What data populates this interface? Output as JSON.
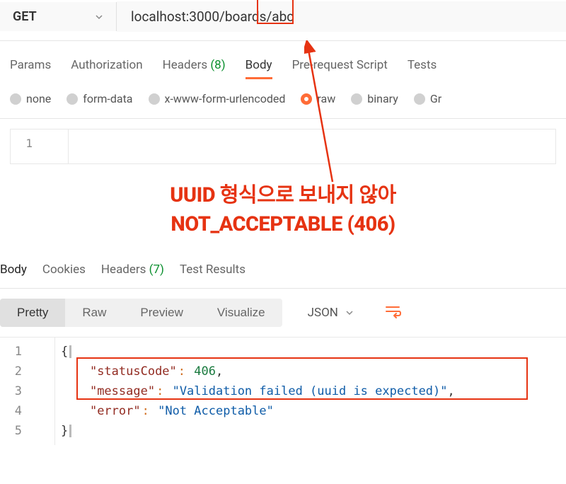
{
  "method": "GET",
  "url": "localhost:3000/boards/abc",
  "url_highlight_segment": "/abc",
  "request_tabs": [
    {
      "label": "Params"
    },
    {
      "label": "Authorization"
    },
    {
      "label": "Headers",
      "count": "(8)"
    },
    {
      "label": "Body",
      "active": true
    },
    {
      "label": "Pre-request Script"
    },
    {
      "label": "Tests"
    }
  ],
  "body_types": [
    {
      "label": "none"
    },
    {
      "label": "form-data"
    },
    {
      "label": "x-www-form-urlencoded"
    },
    {
      "label": "raw",
      "checked": true
    },
    {
      "label": "binary"
    },
    {
      "label": "Gr"
    }
  ],
  "request_editor": {
    "line_numbers": [
      "1"
    ]
  },
  "annotation": {
    "line1": "UUID 형식으로 보내지 않아",
    "line2": "NOT_ACCEPTABLE (406)"
  },
  "response_tabs": [
    {
      "label": "Body",
      "active": true
    },
    {
      "label": "Cookies"
    },
    {
      "label": "Headers",
      "count": "(7)"
    },
    {
      "label": "Test Results"
    }
  ],
  "view_modes": [
    {
      "label": "Pretty",
      "active": true
    },
    {
      "label": "Raw"
    },
    {
      "label": "Preview"
    },
    {
      "label": "Visualize"
    }
  ],
  "response_format": "JSON",
  "response_body": {
    "line_numbers": [
      "1",
      "2",
      "3",
      "4",
      "5"
    ],
    "json": {
      "statusCode": 406,
      "message": "Validation failed (uuid is expected)",
      "error": "Not Acceptable"
    },
    "tokens": [
      {
        "indent": "",
        "type": "brace",
        "text": "{"
      },
      {
        "indent": "    ",
        "key": "statusCode",
        "valType": "num",
        "val": "406",
        "comma": true
      },
      {
        "indent": "    ",
        "key": "message",
        "valType": "str",
        "val": "Validation failed (uuid is expected)",
        "comma": true
      },
      {
        "indent": "    ",
        "key": "error",
        "valType": "str",
        "val": "Not Acceptable",
        "comma": false
      },
      {
        "indent": "",
        "type": "brace",
        "text": "}"
      }
    ]
  }
}
